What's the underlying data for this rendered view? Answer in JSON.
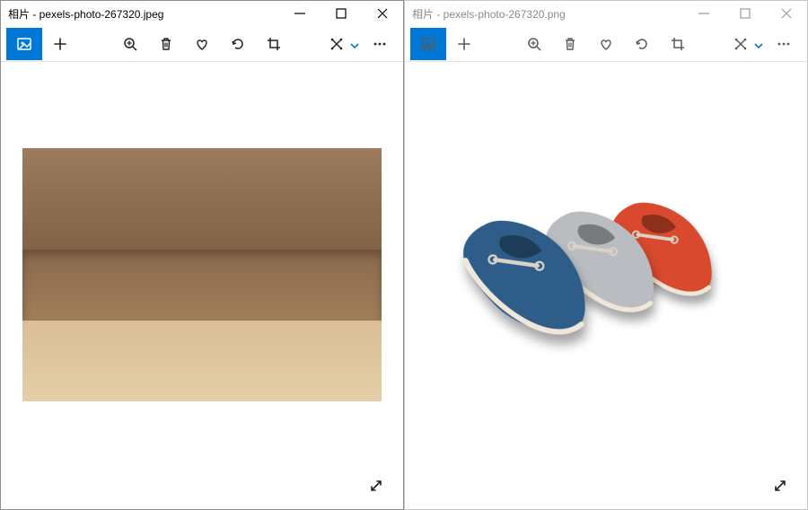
{
  "windows": {
    "left": {
      "title": "相片 - pexels-photo-267320.jpeg",
      "active": true
    },
    "right": {
      "title": "相片 - pexels-photo-267320.png",
      "active": false
    }
  },
  "toolbar": {
    "view_icon": "image",
    "add_icon": "plus",
    "zoom_icon": "zoom",
    "delete_icon": "trash",
    "favorite_icon": "heart",
    "rotate_icon": "rotate",
    "crop_icon": "crop",
    "edit_icon": "edit-magic",
    "more_icon": "ellipsis"
  },
  "image": {
    "subject": "three-loafers",
    "shoes": [
      {
        "color": "#2d5d88",
        "name": "blue"
      },
      {
        "color": "#b9bcc0",
        "name": "grey"
      },
      {
        "color": "#d8492d",
        "name": "orange"
      }
    ],
    "left_has_background": true,
    "right_has_background": false
  },
  "controls": {
    "minimize": "–",
    "maximize": "▢",
    "close": "✕",
    "expand": "↔"
  }
}
